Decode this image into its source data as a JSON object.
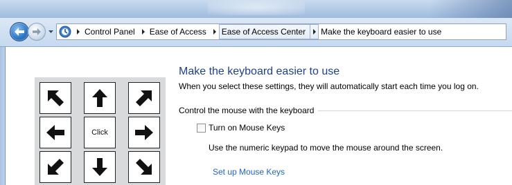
{
  "breadcrumb": {
    "items": [
      "Control Panel",
      "Ease of Access",
      "Ease of Access Center",
      "Make the keyboard easier to use"
    ]
  },
  "icons": {
    "back": "back-arrow-icon",
    "forward": "forward-arrow-icon",
    "control_panel": "control-panel-icon"
  },
  "colors": {
    "title": "#1e3f8f",
    "link": "#1f64c8",
    "address_bar_bg": "#c6d9ef"
  },
  "keyboard_illustration": {
    "keys": [
      "up-left-arrow",
      "up-arrow",
      "up-right-arrow",
      "left-arrow",
      "Click",
      "right-arrow",
      "down-left-arrow",
      "down-arrow",
      "down-right-arrow"
    ],
    "click_label": "Click"
  },
  "main": {
    "title": "Make the keyboard easier to use",
    "subtitle": "When you select these settings, they will automatically start each time you log on.",
    "group_label": "Control the mouse with the keyboard",
    "checkbox_label": "Turn on Mouse Keys",
    "checkbox_checked": false,
    "description": "Use the numeric keypad to move the mouse around the screen.",
    "link_label": "Set up Mouse Keys"
  }
}
